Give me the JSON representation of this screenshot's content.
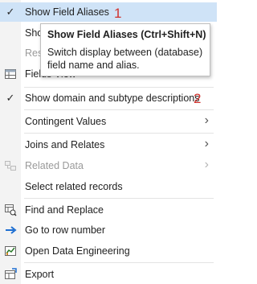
{
  "menu": {
    "show_field_aliases": "Show Field Aliases",
    "show_field_names_partial": "Sho",
    "reset_partial": "Res",
    "field_view_partial": "Fields View",
    "show_domain": "Show domain and subtype descriptions",
    "contingent_values": "Contingent Values",
    "joins_relates": "Joins and Relates",
    "related_data": "Related Data",
    "select_related": "Select related records",
    "find_replace": "Find and Replace",
    "goto_row": "Go to row number",
    "open_data_eng": "Open Data Engineering",
    "export": "Export"
  },
  "annotations": {
    "one": "1",
    "two": "2"
  },
  "tooltip": {
    "title": "Show Field Aliases (Ctrl+Shift+N)",
    "description": "Switch display between (database) field name and alias."
  },
  "colors": {
    "highlight": "#cfe3f7",
    "annotation": "#d0312d",
    "arrow_blue": "#1f6fd1"
  },
  "icons": [
    "check-icon",
    "table-icon",
    "chevron-right-icon",
    "relate-icon",
    "find-replace-icon",
    "arrow-right-icon",
    "data-engineering-icon",
    "export-icon"
  ]
}
